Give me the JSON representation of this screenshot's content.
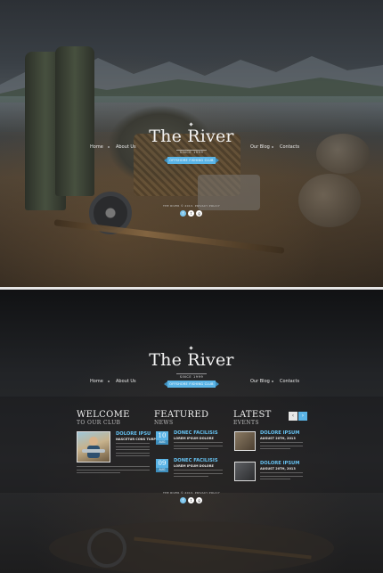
{
  "brand": {
    "title": "The River",
    "since": "SINCE 1999",
    "tagline": "OFFSHORE FISHING CLUB"
  },
  "nav": {
    "home": "Home",
    "about": "About Us",
    "blog": "Our Blog",
    "contacts": "Contacts"
  },
  "footer": {
    "copyright": "THE RIVER © 2013. PRIVACY POLICY",
    "social": [
      "f",
      "t",
      "g"
    ]
  },
  "welcome": {
    "title": "WELCOME",
    "subtitle": "TO OUR CLUB",
    "heading": "DOLORE IPSU",
    "meta": "NASCETUR CONS TURPIS"
  },
  "featured": {
    "title": "FEATURED",
    "subtitle": "NEWS",
    "items": [
      {
        "day": "10",
        "month": "AUG",
        "heading": "DONEC FACILISIS",
        "meta": "LOREM IPSUM DOLORE"
      },
      {
        "day": "09",
        "month": "AUG",
        "heading": "DONEC FACILISIS",
        "meta": "LOREM IPSUM DOLORE"
      }
    ]
  },
  "events": {
    "title": "LATEST",
    "subtitle": "EVENTS",
    "prev": "‹",
    "next": "›",
    "items": [
      {
        "heading": "DOLORE IPSUM",
        "meta": "AUGUST 20TH, 2013"
      },
      {
        "heading": "DOLORE IPSUM",
        "meta": "AUGUST 20TH, 2013"
      }
    ]
  },
  "colors": {
    "accent": "#5ab4e6",
    "heading": "#66c1f0"
  }
}
